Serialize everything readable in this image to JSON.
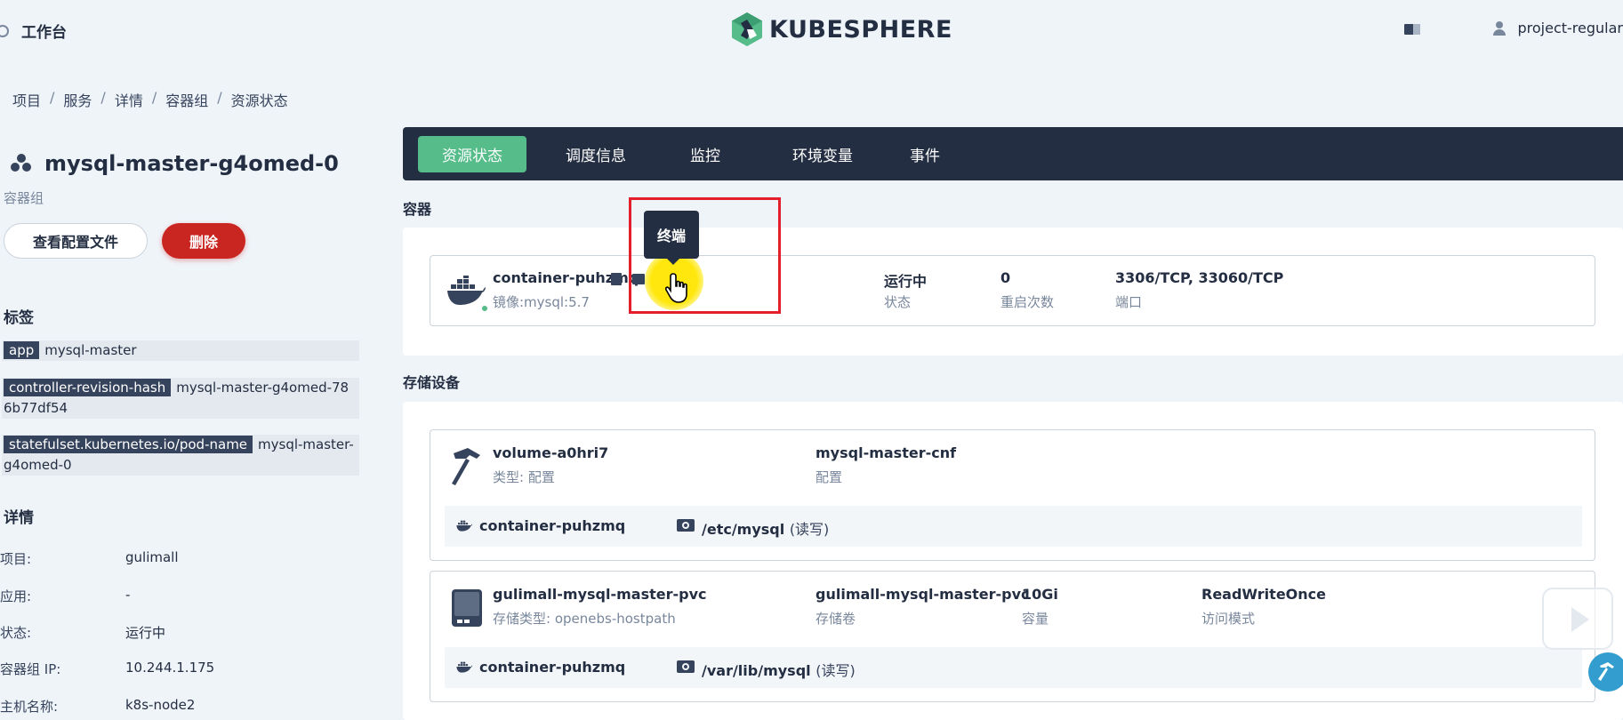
{
  "topbar": {
    "workbench_label": "工作台",
    "logo_text": "KUBESPHERE",
    "user_name": "project-regular"
  },
  "breadcrumb": [
    "项目",
    "服务",
    "详情",
    "容器组",
    "资源状态"
  ],
  "pod": {
    "title": "mysql-master-g4omed-0",
    "subtitle": "容器组",
    "view_config_label": "查看配置文件",
    "delete_label": "删除"
  },
  "labels": {
    "heading": "标签",
    "items": [
      {
        "key": "app",
        "value": "mysql-master"
      },
      {
        "key": "controller-revision-hash",
        "value": "mysql-master-g4omed-786b77df54"
      },
      {
        "key": "statefulset.kubernetes.io/pod-name",
        "value": "mysql-master-g4omed-0"
      }
    ]
  },
  "details": {
    "heading": "详情",
    "rows": [
      {
        "key": "项目:",
        "value": "gulimall"
      },
      {
        "key": "应用:",
        "value": "-"
      },
      {
        "key": "状态:",
        "value": "运行中"
      },
      {
        "key": "容器组 IP:",
        "value": "10.244.1.175"
      },
      {
        "key": "主机名称:",
        "value": "k8s-node2"
      }
    ]
  },
  "tabs": [
    "资源状态",
    "调度信息",
    "监控",
    "环境变量",
    "事件"
  ],
  "containers": {
    "heading": "容器",
    "tooltip": "终端",
    "item": {
      "name": "container-puhzmq",
      "image": "镜像:mysql:5.7",
      "status_value": "运行中",
      "status_label": "状态",
      "restarts_value": "0",
      "restarts_label": "重启次数",
      "ports_value": "3306/TCP, 33060/TCP",
      "ports_label": "端口"
    }
  },
  "storage": {
    "heading": "存储设备",
    "volumes": [
      {
        "name": "volume-a0hri7",
        "type": "类型: 配置",
        "col2_value": "mysql-master-cnf",
        "col2_label": "配置",
        "mount_container": "container-puhzmq",
        "mount_path": "/etc/mysql",
        "mount_mode": "(读写)"
      },
      {
        "name": "gulimall-mysql-master-pvc",
        "type": "存储类型: openebs-hostpath",
        "col2_value": "gulimall-mysql-master-pvc",
        "col2_label": "存储卷",
        "col3_value": "10Gi",
        "col3_label": "容量",
        "col4_value": "ReadWriteOnce",
        "col4_label": "访问模式",
        "mount_container": "container-puhzmq",
        "mount_path": "/var/lib/mysql",
        "mount_mode": "(读写)"
      }
    ]
  },
  "colors": {
    "accent_green": "#55bc8a",
    "danger_red": "#ca2621",
    "dark_navy": "#242e42",
    "highlight_red": "#e41e2b"
  }
}
